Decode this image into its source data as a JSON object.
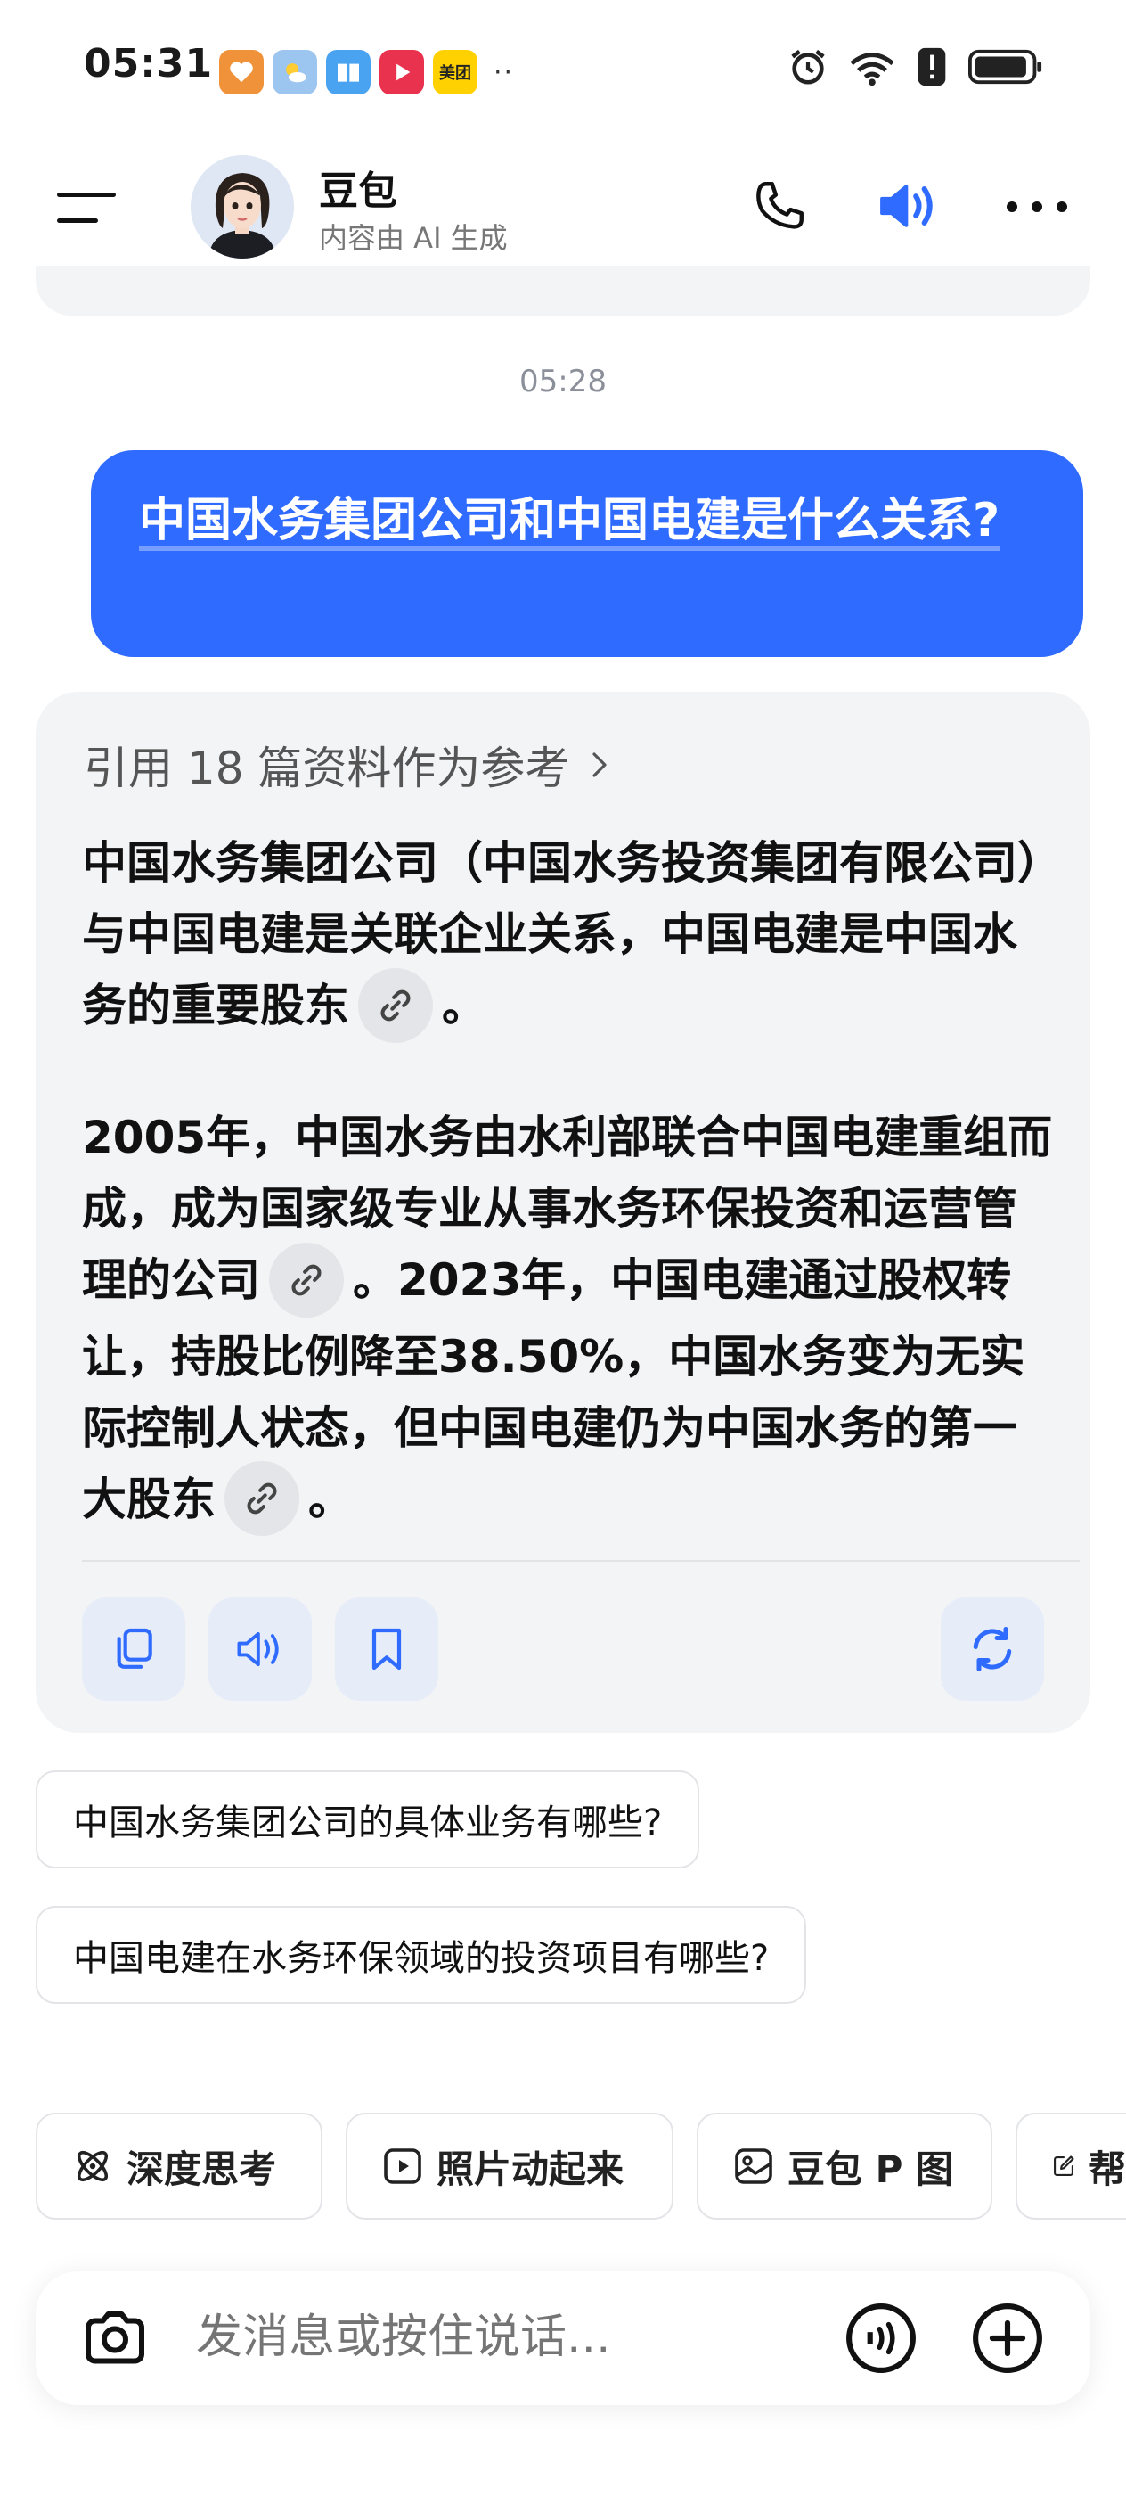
{
  "status_bar": {
    "time": "05:31",
    "apps": [
      {
        "icon": "heart-app-icon",
        "color": "#f0923a",
        "label": ""
      },
      {
        "icon": "weather-app-icon",
        "color": "#9cc5f0",
        "label": ""
      },
      {
        "icon": "book-app-icon",
        "color": "#4aa3f0",
        "label": ""
      },
      {
        "icon": "video-app-icon",
        "color": "#e8324e",
        "label": ""
      },
      {
        "icon": "meituan-app-icon",
        "color": "#ffd100",
        "label": "美团"
      }
    ],
    "more": "··"
  },
  "header": {
    "bot_name": "豆包",
    "subtitle": "内容由 AI 生成"
  },
  "conversation": {
    "timestamp": "05:28",
    "user_message": "中国水务集团公司和中国电建是什么关系?",
    "ai": {
      "references_label": "引用 18 篇资料作为参考",
      "paragraph1": "中国水务集团公司（中国水务投资集团有限公司）与中国电建是关联企业关系，中国电建是中国水务的重要股东",
      "paragraph1_end": "。",
      "paragraph2_a": "2005年，中国水务由水利部联合中国电建重组而成，成为国家级专业从事水务环保投资和运营管理的公司",
      "paragraph2_b": "。2023年，中国电建通过股权转让，持股比例降至38.50%，中国水务变为无实际控制人状态，但中国电建仍为中国水务的第一大股东",
      "paragraph2_end": "。"
    }
  },
  "suggestions": [
    "中国水务集团公司的具体业务有哪些?",
    "中国电建在水务环保领域的投资项目有哪些?"
  ],
  "quick_actions": [
    {
      "label": "深度思考",
      "icon": "atom-icon"
    },
    {
      "label": "照片动起来",
      "icon": "play-icon"
    },
    {
      "label": "豆包 P 图",
      "icon": "image-edit-icon"
    },
    {
      "label": "帮",
      "icon": "write-icon"
    }
  ],
  "input": {
    "placeholder": "发消息或按住说话..."
  },
  "colors": {
    "accent": "#2f6bff",
    "card_bg": "#f3f4f6"
  }
}
